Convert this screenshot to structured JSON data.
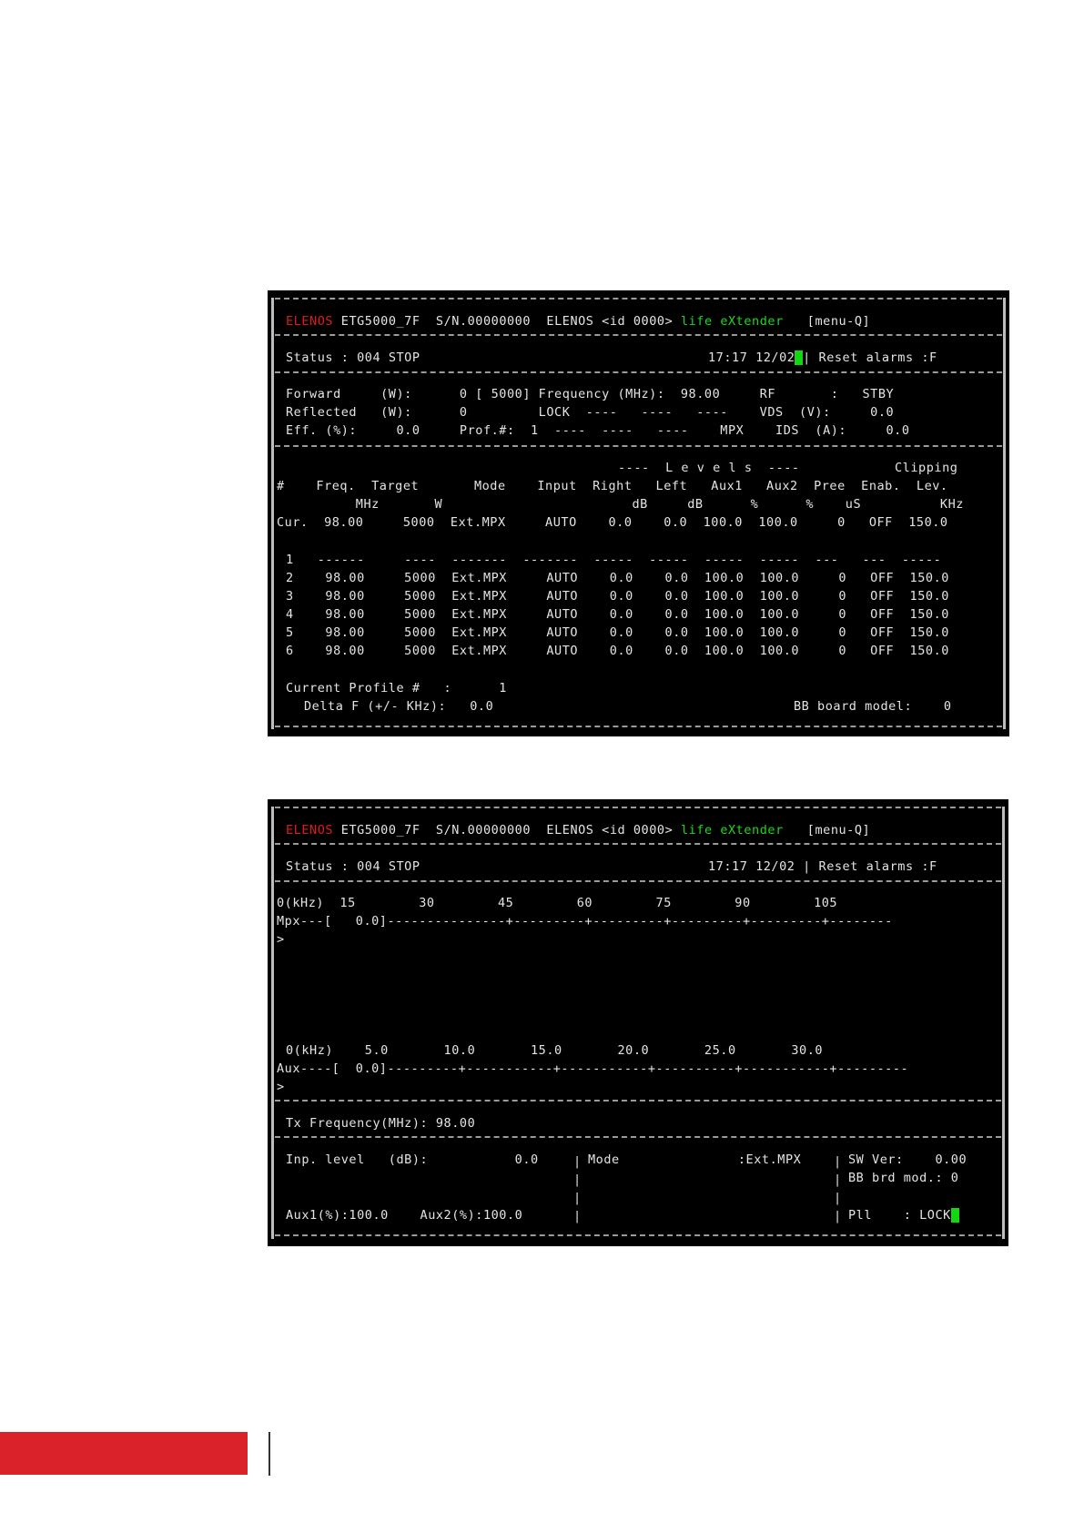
{
  "header": {
    "brand": "ELENOS",
    "model": "ETG5000_7F",
    "serial": "S/N.00000000",
    "id_text": "ELENOS <id 0000>",
    "life": "life eXtender",
    "menu": "[menu-Q]"
  },
  "status_bar": {
    "status_label": "Status :",
    "status_value": "004 STOP",
    "datetime": "17:17 12/02",
    "reset": "Reset alarms :F"
  },
  "screen1": {
    "lines": [
      "Forward     (W):      0 [ 5000] Frequency (MHz):  98.00     RF       :   STBY",
      "Reflected   (W):      0         LOCK  ----   ----   ----    VDS  (V):     0.0",
      "Eff. (%):     0.0     Prof.#:  1  ----  ----   ----    MPX    IDS  (A):     0.0"
    ],
    "levels_header": "----  L e v e l s  ----",
    "clipping_header": "Clipping",
    "col_headers": "#    Freq.  Target       Mode    Input  Right   Left   Aux1   Aux2  Pree  Enab.  Lev.",
    "col_units": "          MHz       W                        dB     dB      %      %    uS          KHz",
    "cur_row": "Cur.  98.00     5000  Ext.MPX     AUTO    0.0    0.0  100.0  100.0     0   OFF  150.0",
    "dash_row": "1   ------     ----  -------  -------  -----  -----  -----  -----  ---   ---  -----",
    "profiles": [
      "2    98.00     5000  Ext.MPX     AUTO    0.0    0.0  100.0  100.0     0   OFF  150.0",
      "3    98.00     5000  Ext.MPX     AUTO    0.0    0.0  100.0  100.0     0   OFF  150.0",
      "4    98.00     5000  Ext.MPX     AUTO    0.0    0.0  100.0  100.0     0   OFF  150.0",
      "5    98.00     5000  Ext.MPX     AUTO    0.0    0.0  100.0  100.0     0   OFF  150.0",
      "6    98.00     5000  Ext.MPX     AUTO    0.0    0.0  100.0  100.0     0   OFF  150.0"
    ],
    "current_profile": "Current Profile #   :      1",
    "delta_f": "Delta F (+/- KHz):   0.0",
    "bb_board": "BB board model:    0"
  },
  "screen2": {
    "mpx_scale": "0(kHz)  15        30        45        60        75        90        105",
    "mpx_bar": "Mpx---[   0.0]---------------+---------+---------+---------+---------+--------",
    "prompt": ">",
    "aux_scale": "0(kHz)    5.0       10.0       15.0       20.0       25.0       30.0",
    "aux_bar": "Aux----[  0.0]---------+-----------+-----------+----------+-----------+---------",
    "tx_freq": "Tx Frequency(MHz): 98.00",
    "inp_level": "Inp. level   (dB):           0.0",
    "aux_levels": "Aux1(%):100.0    Aux2(%):100.0",
    "mode": "Mode               :Ext.MPX",
    "sw_ver": "SW Ver:    0.00",
    "bb_mod": "BB brd mod.: 0",
    "pll": "Pll    : LOCK"
  }
}
